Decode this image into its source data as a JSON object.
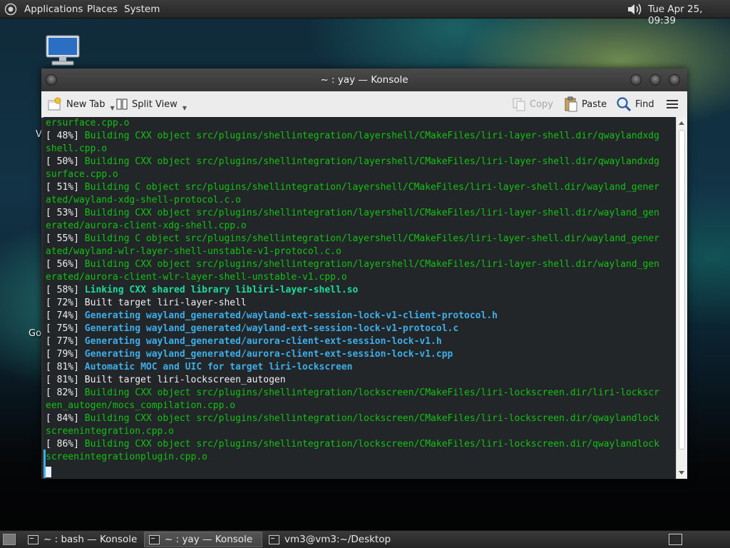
{
  "top_panel": {
    "menus": [
      "Applications",
      "Places",
      "System"
    ],
    "clock": "Tue Apr 25, 09:39"
  },
  "desktop": {
    "labels": [
      "V",
      "Go"
    ]
  },
  "window": {
    "title": "~ : yay — Konsole",
    "toolbar": {
      "new_tab": "New Tab",
      "split_view": "Split View",
      "copy": "Copy",
      "paste": "Paste",
      "find": "Find"
    }
  },
  "terminal": {
    "lines": [
      {
        "text": "ersurface.cpp.o",
        "color": "g"
      },
      {
        "text": "[ 48%] Building CXX object src/plugins/shellintegration/layershell/CMakeFiles/liri-layer-shell.dir/qwaylandxdg",
        "color": "mix"
      },
      {
        "text": "shell.cpp.o",
        "color": "g"
      },
      {
        "text": "[ 50%] Building CXX object src/plugins/shellintegration/layershell/CMakeFiles/liri-layer-shell.dir/qwaylandxdg",
        "color": "mix"
      },
      {
        "text": "surface.cpp.o",
        "color": "g"
      },
      {
        "text": "[ 51%] Building C object src/plugins/shellintegration/layershell/CMakeFiles/liri-layer-shell.dir/wayland_gener",
        "color": "mix"
      },
      {
        "text": "ated/wayland-xdg-shell-protocol.c.o",
        "color": "g"
      },
      {
        "text": "[ 53%] Building CXX object src/plugins/shellintegration/layershell/CMakeFiles/liri-layer-shell.dir/wayland_gen",
        "color": "mix"
      },
      {
        "text": "erated/aurora-client-xdg-shell.cpp.o",
        "color": "g"
      },
      {
        "text": "[ 55%] Building C object src/plugins/shellintegration/layershell/CMakeFiles/liri-layer-shell.dir/wayland_gener",
        "color": "mix"
      },
      {
        "text": "ated/wayland-wlr-layer-shell-unstable-v1-protocol.c.o",
        "color": "g"
      },
      {
        "text": "[ 56%] Building CXX object src/plugins/shellintegration/layershell/CMakeFiles/liri-layer-shell.dir/wayland_gen",
        "color": "mix"
      },
      {
        "text": "erated/aurora-client-wlr-layer-shell-unstable-v1.cpp.o",
        "color": "g"
      },
      {
        "text": "[ 58%] Linking CXX shared library libliri-layer-shell.so",
        "color": "mix-gb"
      },
      {
        "text": "[ 72%] Built target liri-layer-shell",
        "color": "w"
      },
      {
        "text": "[ 74%] Generating wayland_generated/wayland-ext-session-lock-v1-client-protocol.h",
        "color": "mix-bb"
      },
      {
        "text": "[ 75%] Generating wayland_generated/wayland-ext-session-lock-v1-protocol.c",
        "color": "mix-bb"
      },
      {
        "text": "[ 77%] Generating wayland_generated/aurora-client-ext-session-lock-v1.h",
        "color": "mix-bb"
      },
      {
        "text": "[ 79%] Generating wayland_generated/aurora-client-ext-session-lock-v1.cpp",
        "color": "mix-bb"
      },
      {
        "text": "[ 81%] Automatic MOC and UIC for target liri-lockscreen",
        "color": "mix-bb"
      },
      {
        "text": "[ 81%] Built target liri-lockscreen_autogen",
        "color": "w"
      },
      {
        "text": "[ 82%] Building CXX object src/plugins/shellintegration/lockscreen/CMakeFiles/liri-lockscreen.dir/liri-lockscr",
        "color": "mix"
      },
      {
        "text": "een_autogen/mocs_compilation.cpp.o",
        "color": "g"
      },
      {
        "text": "[ 84%] Building CXX object src/plugins/shellintegration/lockscreen/CMakeFiles/liri-lockscreen.dir/qwaylandlock",
        "color": "mix"
      },
      {
        "text": "screenintegration.cpp.o",
        "color": "g"
      },
      {
        "text": "[ 86%] Building CXX object src/plugins/shellintegration/lockscreen/CMakeFiles/liri-lockscreen.dir/qwaylandlock",
        "color": "mix"
      },
      {
        "text": "screenintegrationplugin.cpp.o",
        "color": "g"
      }
    ]
  },
  "taskbar": {
    "tasks": [
      {
        "label": "~ : bash — Konsole",
        "active": false
      },
      {
        "label": "~ : yay — Konsole",
        "active": true
      },
      {
        "label": "vm3@vm3:~/Desktop",
        "active": false
      }
    ]
  },
  "colors": {
    "green": "#11c211",
    "teal_bold": "#1cdc9a",
    "blue_bold": "#3daee9",
    "terminal_bg": "#232629",
    "terminal_fg": "#eff0f1"
  }
}
